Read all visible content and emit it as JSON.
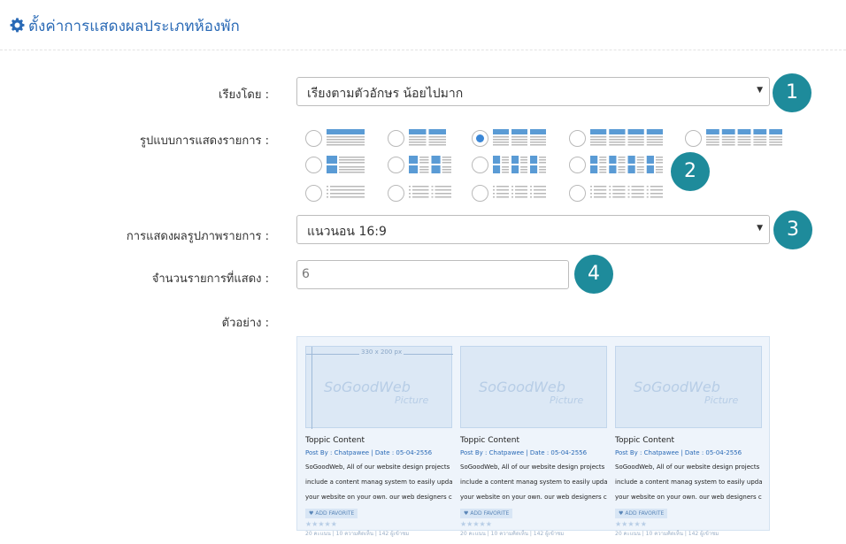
{
  "header": {
    "icon": "gear-icon",
    "title": "ตั้งค่าการแสดงผลประเภทห้องพัก"
  },
  "form": {
    "sort": {
      "label": "เรียงโดย :",
      "value": "เรียงตามตัวอักษร น้อยไปมาก",
      "badge": "1"
    },
    "layout": {
      "label": "รูปแบบการแสดงรายการ :",
      "badge": "2",
      "selected": "grid-3"
    },
    "image_display": {
      "label": "การแสดงผลรูปภาพรายการ :",
      "value": "แนวนอน 16:9",
      "badge": "3"
    },
    "count": {
      "label": "จำนวนรายการที่แสดง :",
      "value": "6",
      "badge": "4"
    },
    "preview": {
      "label": "ตัวอย่าง :"
    }
  },
  "preview_cards": [
    {
      "size": "330 x 200 px",
      "logo": "SoGoodWeb",
      "logo_sub": "Picture",
      "title": "Toppic Content",
      "meta": "Post By : Chatpawee  |  Date : 05-04-2556",
      "desc1": "SoGoodWeb, All of our website design projects",
      "desc2": "include a content manag system to easily update",
      "desc3": "your website on your own. our web designers can",
      "fav": "ADD FAVORITE",
      "stars": "★★★★★",
      "stats": "20 คะแนน | 10 ความคิดเห็น | 142 ผู้เข้าชม"
    },
    {
      "size": "",
      "logo": "SoGoodWeb",
      "logo_sub": "Picture",
      "title": "Toppic Content",
      "meta": "Post By : Chatpawee  |  Date : 05-04-2556",
      "desc1": "SoGoodWeb, All of our website design projects",
      "desc2": "include a content manag system to easily update",
      "desc3": "your website on your own. our web designers can",
      "fav": "ADD FAVORITE",
      "stars": "★★★★★",
      "stats": "20 คะแนน | 10 ความคิดเห็น | 142 ผู้เข้าชม"
    },
    {
      "size": "",
      "logo": "SoGoodWeb",
      "logo_sub": "Picture",
      "title": "Toppic Content",
      "meta": "Post By : Chatpawee  |  Date : 05-04-2556",
      "desc1": "SoGoodWeb, All of our website design projects",
      "desc2": "include a content manag system to easily update",
      "desc3": "your website on your own. our web designers can",
      "fav": "ADD FAVORITE",
      "stars": "★★★★★",
      "stats": "20 คะแนน | 10 ความคิดเห็น | 142 ผู้เข้าชม"
    }
  ],
  "colors": {
    "accent": "#2a6ab6",
    "badge": "#1e8b9b",
    "radio_selected": "#3b87d6",
    "layout_icon": "#5a9bd5"
  }
}
